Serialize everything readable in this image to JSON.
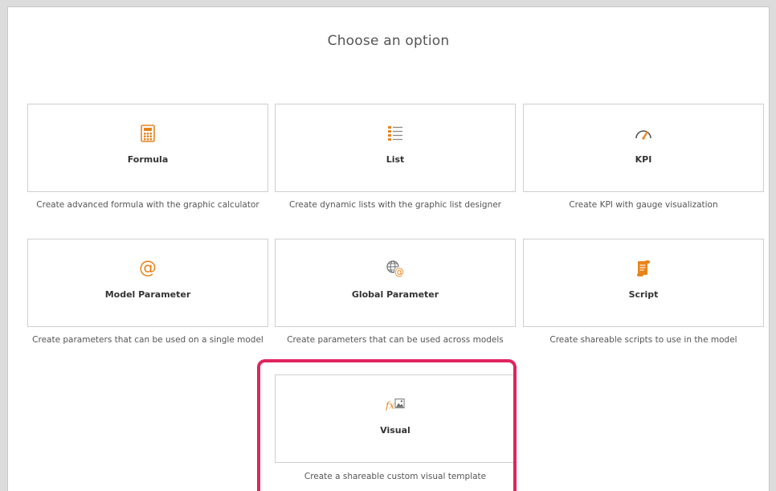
{
  "page": {
    "title": "Choose an option"
  },
  "options": [
    {
      "label": "Formula",
      "icon": "calculator-icon",
      "description": "Create advanced formula with the graphic calculator"
    },
    {
      "label": "List",
      "icon": "list-icon",
      "description": "Create dynamic lists with the graphic list designer"
    },
    {
      "label": "KPI",
      "icon": "gauge-icon",
      "description": "Create KPI with gauge visualization"
    },
    {
      "label": "Model Parameter",
      "icon": "at-sign-icon",
      "description": "Create parameters that can be used on a single model"
    },
    {
      "label": "Global Parameter",
      "icon": "globe-at-icon",
      "description": "Create parameters that can be used across models"
    },
    {
      "label": "Script",
      "icon": "script-scroll-icon",
      "description": "Create shareable scripts to use in the model"
    },
    {
      "label": "Visual",
      "icon": "visual-template-icon",
      "description": "Create a shareable custom visual template"
    }
  ],
  "colors": {
    "accent": "#e8841c",
    "highlight": "#e0245e",
    "border": "#cfcfcf"
  }
}
